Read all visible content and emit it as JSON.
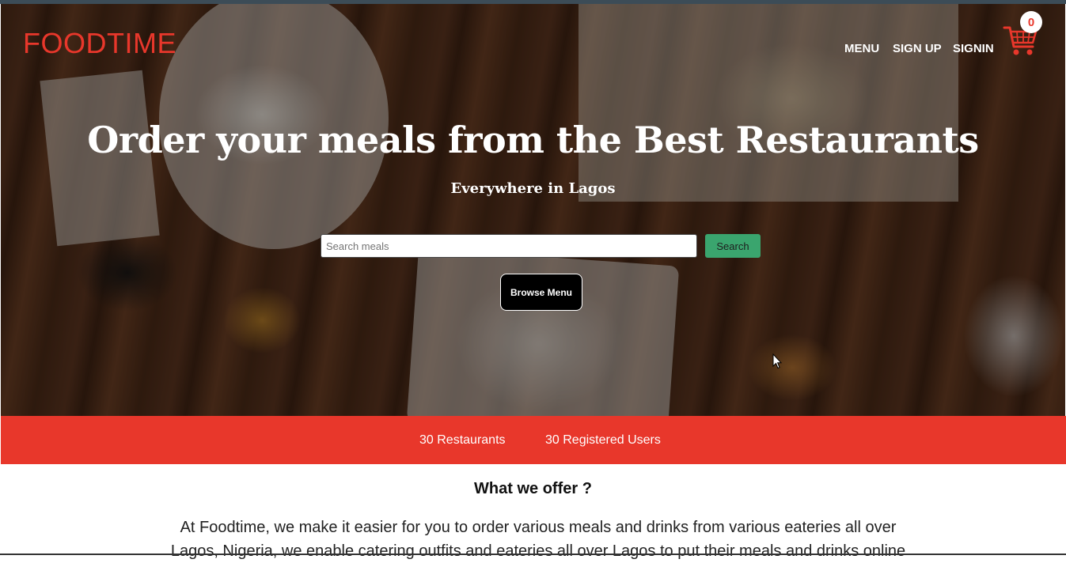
{
  "brand": {
    "name": "FOODTIME",
    "accent": "#e8372b"
  },
  "nav": {
    "items": [
      {
        "label": "MENU"
      },
      {
        "label": "SIGN UP"
      },
      {
        "label": "SIGNIN"
      }
    ],
    "cart": {
      "icon": "shopping-cart-icon",
      "count": "0"
    }
  },
  "hero": {
    "title": "Order your meals from the Best Restaurants",
    "subtitle": "Everywhere in Lagos",
    "search": {
      "placeholder": "Search meals",
      "value": "",
      "button_label": "Search"
    },
    "browse_label": "Browse Menu"
  },
  "stats": {
    "restaurants": "30 Restaurants",
    "users": "30 Registered Users"
  },
  "offer": {
    "title": "What we offer ?",
    "text": "At Foodtime, we make it easier for you to order various meals and drinks from various eateries all over Lagos, Nigeria, we enable catering outfits and eateries all over Lagos to put their meals and drinks online"
  },
  "colors": {
    "search_button": "#3aa56e",
    "stats_bar": "#e8372b"
  }
}
